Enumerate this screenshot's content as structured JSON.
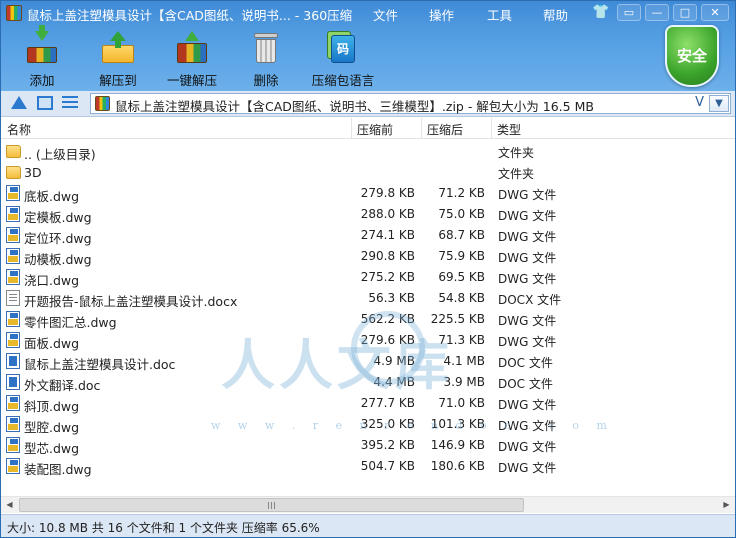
{
  "window": {
    "title": "鼠标上盖注塑模具设计【含CAD图纸、说明书... - 360压缩",
    "menu": [
      "文件",
      "操作",
      "工具",
      "帮助"
    ]
  },
  "toolbar": {
    "add": "添加",
    "extract": "解压到",
    "one_click": "一键解压",
    "delete": "删除",
    "language": "压缩包语言",
    "security": "安全",
    "lang_glyph": "码"
  },
  "address": {
    "path": "鼠标上盖注塑模具设计【含CAD图纸、说明书、三维模型】.zip - 解包大小为 16.5 MB",
    "dropdown": "V"
  },
  "columns": {
    "name": "名称",
    "size": "压缩前",
    "packed": "压缩后",
    "type": "类型"
  },
  "files": [
    {
      "name": ".. (上级目录)",
      "size": "",
      "packed": "",
      "type": "文件夹",
      "icon": "folder-icon"
    },
    {
      "name": "3D",
      "size": "",
      "packed": "",
      "type": "文件夹",
      "icon": "folder-icon"
    },
    {
      "name": "底板.dwg",
      "size": "279.8 KB",
      "packed": "71.2 KB",
      "type": "DWG 文件",
      "icon": "dwg-file-icon"
    },
    {
      "name": "定模板.dwg",
      "size": "288.0 KB",
      "packed": "75.0 KB",
      "type": "DWG 文件",
      "icon": "dwg-file-icon"
    },
    {
      "name": "定位环.dwg",
      "size": "274.1 KB",
      "packed": "68.7 KB",
      "type": "DWG 文件",
      "icon": "dwg-file-icon"
    },
    {
      "name": "动模板.dwg",
      "size": "290.8 KB",
      "packed": "75.9 KB",
      "type": "DWG 文件",
      "icon": "dwg-file-icon"
    },
    {
      "name": "浇口.dwg",
      "size": "275.2 KB",
      "packed": "69.5 KB",
      "type": "DWG 文件",
      "icon": "dwg-file-icon"
    },
    {
      "name": "开题报告-鼠标上盖注塑模具设计.docx",
      "size": "56.3 KB",
      "packed": "54.8 KB",
      "type": "DOCX 文件",
      "icon": "docx-file-icon"
    },
    {
      "name": "零件图汇总.dwg",
      "size": "562.2 KB",
      "packed": "225.5 KB",
      "type": "DWG 文件",
      "icon": "dwg-file-icon"
    },
    {
      "name": "面板.dwg",
      "size": "279.6 KB",
      "packed": "71.3 KB",
      "type": "DWG 文件",
      "icon": "dwg-file-icon"
    },
    {
      "name": "鼠标上盖注塑模具设计.doc",
      "size": "4.9 MB",
      "packed": "4.1 MB",
      "type": "DOC 文件",
      "icon": "doc-file-icon"
    },
    {
      "name": "外文翻译.doc",
      "size": "4.4 MB",
      "packed": "3.9 MB",
      "type": "DOC 文件",
      "icon": "doc-file-icon"
    },
    {
      "name": "斜顶.dwg",
      "size": "277.7 KB",
      "packed": "71.0 KB",
      "type": "DWG 文件",
      "icon": "dwg-file-icon"
    },
    {
      "name": "型腔.dwg",
      "size": "325.0 KB",
      "packed": "101.3 KB",
      "type": "DWG 文件",
      "icon": "dwg-file-icon"
    },
    {
      "name": "型芯.dwg",
      "size": "395.2 KB",
      "packed": "146.9 KB",
      "type": "DWG 文件",
      "icon": "dwg-file-icon"
    },
    {
      "name": "装配图.dwg",
      "size": "504.7 KB",
      "packed": "180.6 KB",
      "type": "DWG 文件",
      "icon": "dwg-file-icon"
    }
  ],
  "watermark": {
    "text": "人人文库",
    "url": "w w w . r e n r e n d o c . c o m"
  },
  "status": {
    "text": "大小: 10.8 MB 共 16 个文件和 1 个文件夹 压缩率 65.6%"
  }
}
